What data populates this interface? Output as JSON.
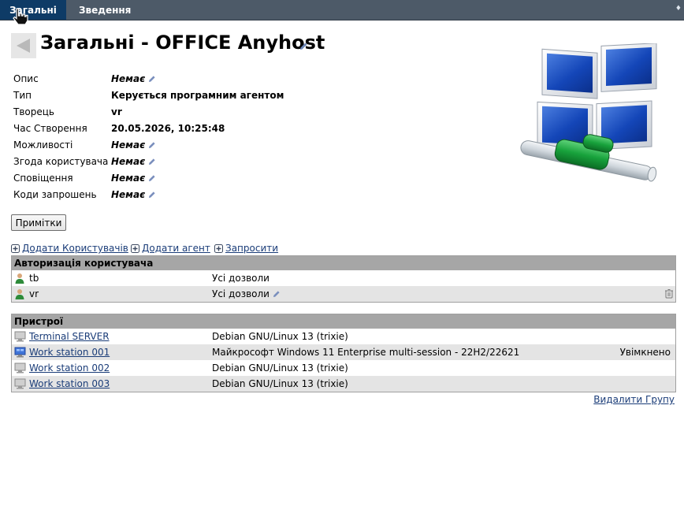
{
  "tabs": [
    {
      "label": "Загальні"
    },
    {
      "label": "Зведення"
    }
  ],
  "menu_glyph": "♦",
  "title": "Загальні - OFFICE Anyhost",
  "properties": [
    {
      "label": "Опис",
      "value": "Немає",
      "editable": true
    },
    {
      "label": "Тип",
      "value": "Керується програмним агентом",
      "editable": false
    },
    {
      "label": "Творець",
      "value": "vr",
      "editable": false
    },
    {
      "label": "Час Створення",
      "value": "20.05.2026, 10:25:48",
      "editable": false
    },
    {
      "label": "Можливості",
      "value": "Немає",
      "editable": true
    },
    {
      "label": "Згода користувача",
      "value": "Немає",
      "editable": true
    },
    {
      "label": "Сповіщення",
      "value": "Немає",
      "editable": true
    },
    {
      "label": "Коди запрошень",
      "value": "Немає",
      "editable": true
    }
  ],
  "notes_button": "Примітки",
  "actions": {
    "add_users": "Додати Користувачів",
    "add_agent": "Додати агент",
    "invite": "Запросити"
  },
  "users_panel": {
    "header": "Авторизація користувача",
    "rows": [
      {
        "name": "tb",
        "rights": "Усі дозволи"
      },
      {
        "name": "vr",
        "rights": "Усі дозволи"
      }
    ]
  },
  "devices_panel": {
    "header": "Пристрої",
    "rows": [
      {
        "name": "Terminal SERVER",
        "os": "Debian GNU/Linux 13 (trixie)",
        "status": "",
        "icon": "linux-server-icon"
      },
      {
        "name": "Work station 001",
        "os": "Майкрософт Windows 11 Enterprise multi-session - 22H2/22621",
        "status": "Увімкнено",
        "icon": "windows-desktop-icon"
      },
      {
        "name": "Work station 002",
        "os": "Debian GNU/Linux 13 (trixie)",
        "status": "",
        "icon": "linux-server-icon"
      },
      {
        "name": "Work station 003",
        "os": "Debian GNU/Linux 13 (trixie)",
        "status": "",
        "icon": "linux-server-icon"
      }
    ]
  },
  "delete_group": "Видалити Групу",
  "colors": {
    "topbar": "#4d5a68",
    "active_tab": "#0e3b66",
    "link": "#1a3c78",
    "panel_header": "#a6a6a6",
    "row_alt": "#e4e4e4"
  }
}
